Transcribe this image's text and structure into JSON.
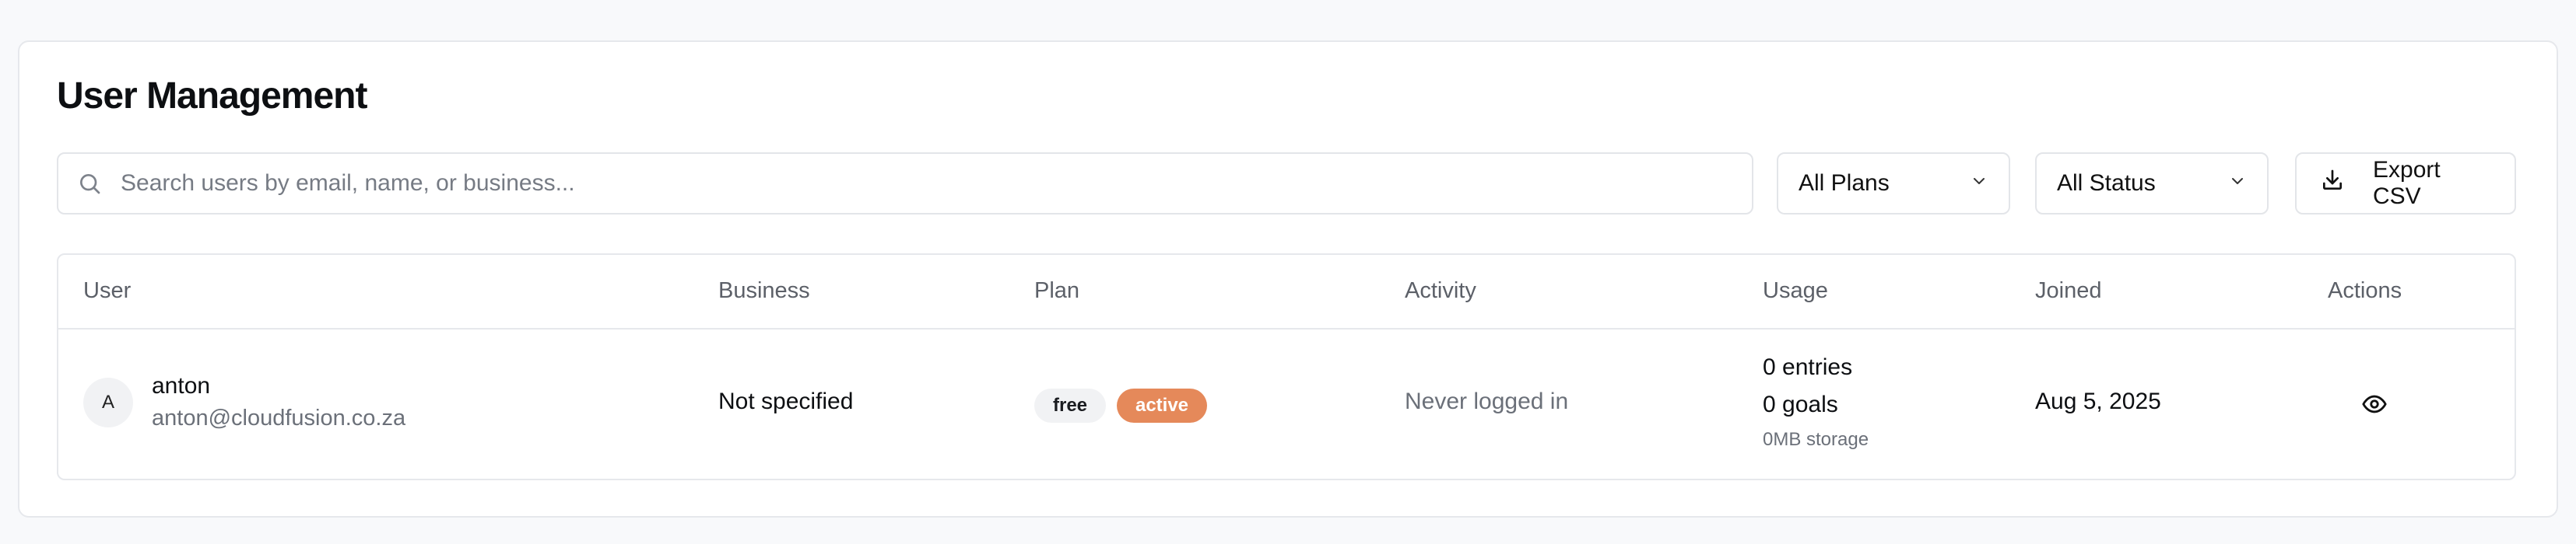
{
  "header": {
    "title": "User Management"
  },
  "search": {
    "placeholder": "Search users by email, name, or business..."
  },
  "filters": {
    "plan": {
      "selected": "All Plans"
    },
    "status": {
      "selected": "All Status"
    }
  },
  "toolbar": {
    "export_label": "Export CSV"
  },
  "table": {
    "columns": [
      "User",
      "Business",
      "Plan",
      "Activity",
      "Usage",
      "Joined",
      "Actions"
    ],
    "rows": [
      {
        "avatar_initial": "A",
        "name": "anton",
        "email": "anton@cloudfusion.co.za",
        "business": "Not specified",
        "plan": "free",
        "status": "active",
        "activity": "Never logged in",
        "usage_entries": "0 entries",
        "usage_goals": "0 goals",
        "usage_storage": "0MB storage",
        "joined": "Aug 5, 2025",
        "action_icon": "eye-icon"
      }
    ]
  },
  "colors": {
    "active_badge": "#e5895a",
    "free_badge_bg": "#f1f2f4",
    "border": "#e6e8ec"
  }
}
